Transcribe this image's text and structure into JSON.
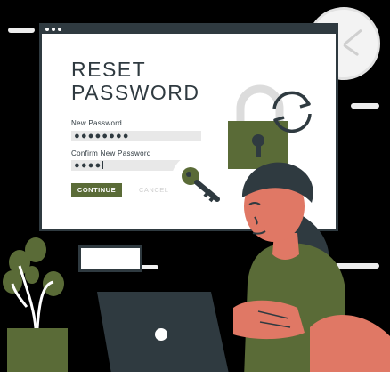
{
  "window": {
    "title_line1": "RESET",
    "title_line2": "PASSWORD",
    "new_password_label": "New Password",
    "new_password_value": "●●●●●●●●",
    "confirm_password_label": "Confirm New Password",
    "confirm_password_value": "●●●●",
    "continue_label": "CONTINUE",
    "cancel_label": "CANCEL"
  },
  "colors": {
    "accent": "#5a6b37",
    "dark": "#2f3a40",
    "skin": "#e07865",
    "shirt": "#5a6b37"
  },
  "icons": [
    "lock-icon",
    "refresh-arrows-icon",
    "key-icon",
    "clock-icon",
    "plant-icon",
    "laptop-icon"
  ]
}
